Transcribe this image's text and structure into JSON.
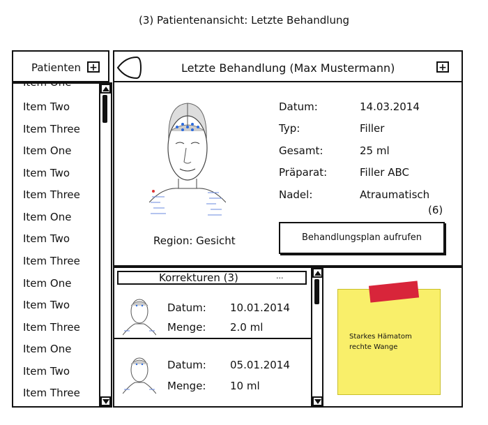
{
  "page": {
    "title": "(3) Patientenansicht: Letzte Behandlung"
  },
  "sidebar": {
    "title": "Patienten",
    "add_label": "+",
    "items": [
      "Item One",
      "Item Two",
      "Item Three",
      "Item One",
      "Item Two",
      "Item Three",
      "Item One",
      "Item Two",
      "Item Three",
      "Item One",
      "Item Two",
      "Item Three",
      "Item One",
      "Item Two",
      "Item Three"
    ]
  },
  "header": {
    "title": "Letzte Behandlung (Max Mustermann)",
    "add_label": "+"
  },
  "treatment": {
    "region": "Region: Gesicht",
    "fields": [
      {
        "label": "Datum:",
        "value": "14.03.2014"
      },
      {
        "label": "Typ:",
        "value": "Filler"
      },
      {
        "label": "Gesamt:",
        "value": "25 ml"
      },
      {
        "label": "Präparat:",
        "value": "Filler ABC"
      },
      {
        "label": "Nadel:",
        "value": "Atraumatisch"
      }
    ],
    "marker": "(6)",
    "plan_button": "Behandlungsplan aufrufen"
  },
  "corrections": {
    "title": "Korrekturen (3)",
    "ellipsis": "...",
    "rows": [
      {
        "date_label": "Datum:",
        "date": "10.01.2014",
        "qty_label": "Menge:",
        "qty": "2.0 ml"
      },
      {
        "date_label": "Datum:",
        "date": "05.01.2014",
        "qty_label": "Menge:",
        "qty": "10 ml"
      }
    ]
  },
  "note": {
    "lines": [
      "Starkes Hämatom",
      "rechte Wange"
    ],
    "color": "#f9ef6a",
    "tape_color": "#d8253a"
  }
}
